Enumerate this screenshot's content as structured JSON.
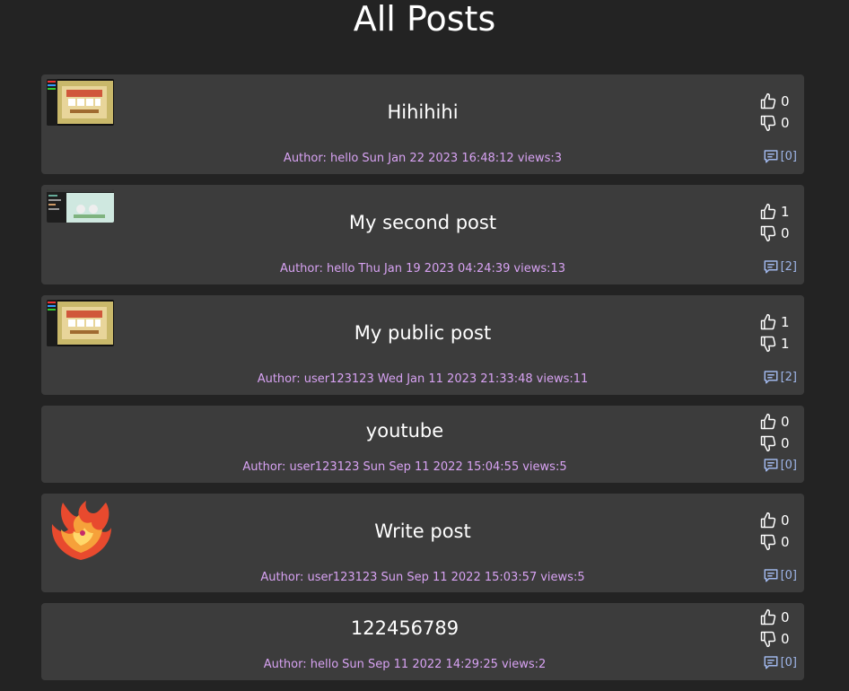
{
  "page": {
    "title": "All Posts"
  },
  "posts": [
    {
      "title": "Hihihihi",
      "author": "Author: hello",
      "date": "Sun Jan 22 2023 16:48:12",
      "views": "views:3",
      "likes": "0",
      "dislikes": "0",
      "comments": "[0]",
      "thumbnail": "game-screenshot"
    },
    {
      "title": "My second post",
      "author": "Author: hello",
      "date": "Thu Jan 19 2023 04:24:39",
      "views": "views:13",
      "likes": "1",
      "dislikes": "0",
      "comments": "[2]",
      "thumbnail": "code-screenshot"
    },
    {
      "title": "My public post",
      "author": "Author: user123123",
      "date": "Wed Jan 11 2023 21:33:48",
      "views": "views:11",
      "likes": "1",
      "dislikes": "1",
      "comments": "[2]",
      "thumbnail": "game-screenshot"
    },
    {
      "title": "youtube",
      "author": "Author: user123123",
      "date": "Sun Sep 11 2022 15:04:55",
      "views": "views:5",
      "likes": "0",
      "dislikes": "0",
      "comments": "[0]",
      "thumbnail": ""
    },
    {
      "title": "Write post",
      "author": "Author: user123123",
      "date": "Sun Sep 11 2022 15:03:57",
      "views": "views:5",
      "likes": "0",
      "dislikes": "0",
      "comments": "[0]",
      "thumbnail": "phoenix-logo"
    },
    {
      "title": "122456789",
      "author": "Author: hello",
      "date": "Sun Sep 11 2022 14:29:25",
      "views": "views:2",
      "likes": "0",
      "dislikes": "0",
      "comments": "[0]",
      "thumbnail": ""
    }
  ],
  "colors": {
    "background": "#232323",
    "card": "#3c3c3c",
    "meta": "#d7a2f2",
    "comments": "#9fb6ea"
  },
  "icons": {
    "like": "thumbs-up-icon",
    "dislike": "thumbs-down-icon",
    "comments": "comment-icon"
  }
}
